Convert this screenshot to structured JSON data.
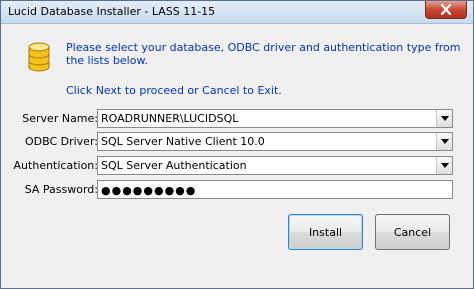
{
  "window": {
    "title": "Lucid Database Installer - LASS 11-15"
  },
  "instructions": {
    "line1": "Please select your database, ODBC driver and authentication type from the lists below.",
    "line2": "Click Next to proceed or Cancel to Exit."
  },
  "form": {
    "server_name": {
      "label": "Server Name:",
      "value": "ROADRUNNER\\LUCIDSQL"
    },
    "odbc_driver": {
      "label": "ODBC Driver:",
      "value": "SQL Server Native Client 10.0"
    },
    "authentication": {
      "label": "Authentication:",
      "value": "SQL Server Authentication"
    },
    "sa_password": {
      "label": "SA Password:",
      "value": "●●●●●●●●●"
    }
  },
  "buttons": {
    "install": "Install",
    "cancel": "Cancel"
  },
  "icons": {
    "app": "database-icon",
    "close": "close-icon",
    "dropdown": "chevron-down-icon"
  },
  "colors": {
    "instruction_text": "#0033cc",
    "close_button": "#c94a35",
    "database_icon": "#f3c21b"
  }
}
